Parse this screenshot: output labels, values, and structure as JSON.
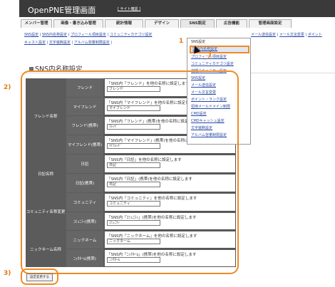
{
  "header": {
    "title": "OpenPNE管理画面",
    "site_link": "[ サイト確認 ]"
  },
  "tabs": [
    "メンバー管理",
    "画像・書き込み管理",
    "統計情報",
    "デザイン",
    "SNS設定",
    "広告機能",
    "管理画面設定"
  ],
  "subnav": {
    "row1": [
      "SNS設定",
      "SNS内名称設定",
      "プロフィール項目設定",
      "コミュニティカテゴリ設定",
      "SNS設定",
      "メール送信設定",
      "メール文言変更",
      "ポイント"
    ],
    "row2": [
      "キャスト設定",
      "文字装飾設定",
      "アルバム容量制限設定"
    ]
  },
  "dropdown": {
    "head": "SNS設定",
    "items": [
      "SNS内名称設定",
      "プロフィール項目設定",
      "コミュニティカテゴリ設定",
      "初期コミュニティ設定",
      "SNS設定",
      "メール送信設定",
      "メール文言変更",
      "ポイント・ランク設定",
      "招待メールドメイン制限",
      "CMD設定",
      "CMDキャッシュ設定",
      "文字装飾設定",
      "アルバム容量制限設定"
    ]
  },
  "page_title": "SNS内名称設定",
  "steps": {
    "s1": "1",
    "s2": "2)",
    "s3": "3)"
  },
  "groups": [
    {
      "label": "フレンド名称",
      "rows": [
        {
          "label": "フレンド",
          "desc": "「SNS内「フレンド」を他の名称に設定します",
          "value": "フレンド"
        },
        {
          "label": "マイフレンド",
          "desc": "「SNS内「マイフレンド」を他の名称に設定します",
          "value": "マイフレンド"
        },
        {
          "label": "フレンド(携帯)",
          "desc": "「SNS内「フレンド」(携帯)を他の名称に設定します",
          "value": "ﾌﾚﾝﾄﾞ"
        },
        {
          "label": "マイフレンド(携帯)",
          "desc": "「SNS内「マイフレンド」(携帯)を他の名称に設定します",
          "value": "ﾏｲﾌﾚﾝﾄﾞ"
        }
      ]
    },
    {
      "label": "日記名称",
      "rows": [
        {
          "label": "日記",
          "desc": "「SNS内「日記」を他の名称に設定します",
          "value": "日記"
        },
        {
          "label": "日記(携帯)",
          "desc": "「SNS内「日記」(携帯)を他の名称に設定します",
          "value": "日記"
        }
      ]
    },
    {
      "label": "コミュニティ名称変更",
      "rows": [
        {
          "label": "コミュニティ",
          "desc": "「SNS内「コミュニティ」を他の名称に設定します",
          "value": "コミュニティ"
        },
        {
          "label": "ｺﾐｭﾆﾃｨ(携帯)",
          "desc": "「SNS内「ｺﾐｭﾆﾃｨ」(携帯)を他の名称に設定します",
          "value": "ｺﾐｭﾆﾃｨ"
        }
      ]
    },
    {
      "label": "ニックネーム名称",
      "rows": [
        {
          "label": "ニックネーム",
          "desc": "「SNS内「ニックネーム」を他の名称に設定します",
          "value": "ニックネーム"
        },
        {
          "label": "ﾆｯｸﾈｰﾑ(携帯)",
          "desc": "「SNS内「ﾆｯｸﾈｰﾑ」(携帯)を他の名称に設定します",
          "value": "ﾆｯｸﾈｰﾑ"
        }
      ]
    }
  ],
  "submit_label": "設定変更する"
}
